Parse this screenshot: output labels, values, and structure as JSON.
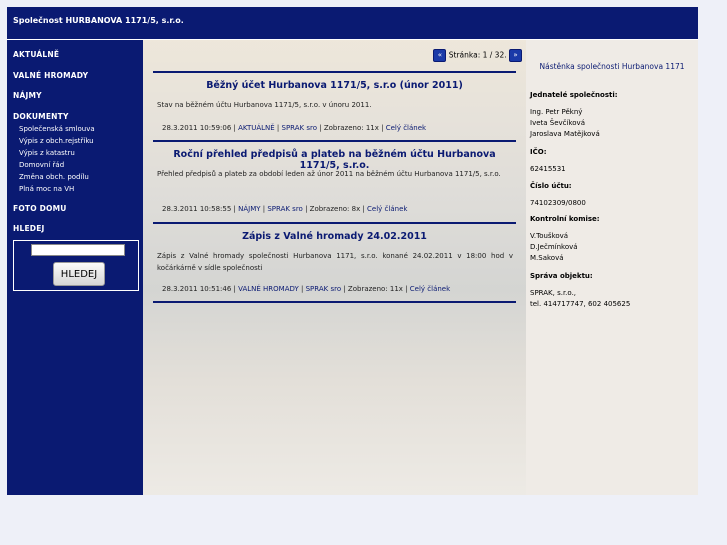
{
  "header": {
    "title": "Společnost HURBANOVA 1171/5, s.r.o."
  },
  "sidebar": {
    "aktualne": "AKTUÁLNĚ",
    "valne": "VALNÉ HROMADY",
    "najmy": "NÁJMY",
    "dokumenty": "DOKUMENTY",
    "dokumenty_items": [
      "Společenská smlouva",
      "Výpis z obch.rejstříku",
      "Výpis z katastru",
      "Domovní řád",
      "Změna obch. podílu",
      "Plná moc na VH"
    ],
    "foto": "FOTO DOMU",
    "hledej": "HLEDEJ",
    "search_button": "HLEDEJ"
  },
  "pager": {
    "label": "Stránka: 1 / 32."
  },
  "articles": [
    {
      "title": "Běžný účet Hurbanova 1171/5, s.r.o (únor 2011)",
      "body": "Stav na běžném účtu Hurbanova 1171/5, s.r.o. v únoru 2011.",
      "date": "28.3.2011 10:59:06",
      "category": "AKTUÁLNĚ",
      "author": "SPRAK sro",
      "views": "Zobrazeno: 11x",
      "more": "Celý článek"
    },
    {
      "title": "Roční přehled předpisů a plateb na běžném účtu Hurbanova 1171/5, s.r.o.",
      "body": "Přehled předpisů a plateb za období leden až únor 2011 na běžném účtu Hurbanova 1171/5, s.r.o.",
      "date": "28.3.2011 10:58:55",
      "category": "NÁJMY",
      "author": "SPRAK sro",
      "views": "Zobrazeno: 8x",
      "more": "Celý článek"
    },
    {
      "title": "Zápis z Valné hromady 24.02.2011",
      "body": "Zápis z Valné hromady společnosti Hurbanova 1171, s.r.o. konané 24.02.2011 v 18:00 hod v kočárkárně v sídle společnosti",
      "date": "28.3.2011 10:51:46",
      "category": "VALNÉ HROMADY",
      "author": "SPRAK sro",
      "views": "Zobrazeno: 11x",
      "more": "Celý článek"
    }
  ],
  "right": {
    "title": "Nástěnka společnosti Hurbanova 1171",
    "jednatele_head": "Jednatelé společnosti:",
    "jednatele": [
      "Ing. Petr Pěkný",
      "Iveta Ševčíková",
      "Jaroslava Matějková"
    ],
    "ico_head": "IČO:",
    "ico": "62415531",
    "ucet_head": "Číslo účtu:",
    "ucet": "74102309/0800",
    "komise_head": "Kontrolní komise:",
    "komise": [
      "V.Toušková",
      "D.Ječmínková",
      "M.Saková"
    ],
    "sprava_head": "Správa objektu:",
    "sprava": [
      "SPRAK, s.r.o.,",
      "tel. 414717747, 602 405625"
    ]
  }
}
